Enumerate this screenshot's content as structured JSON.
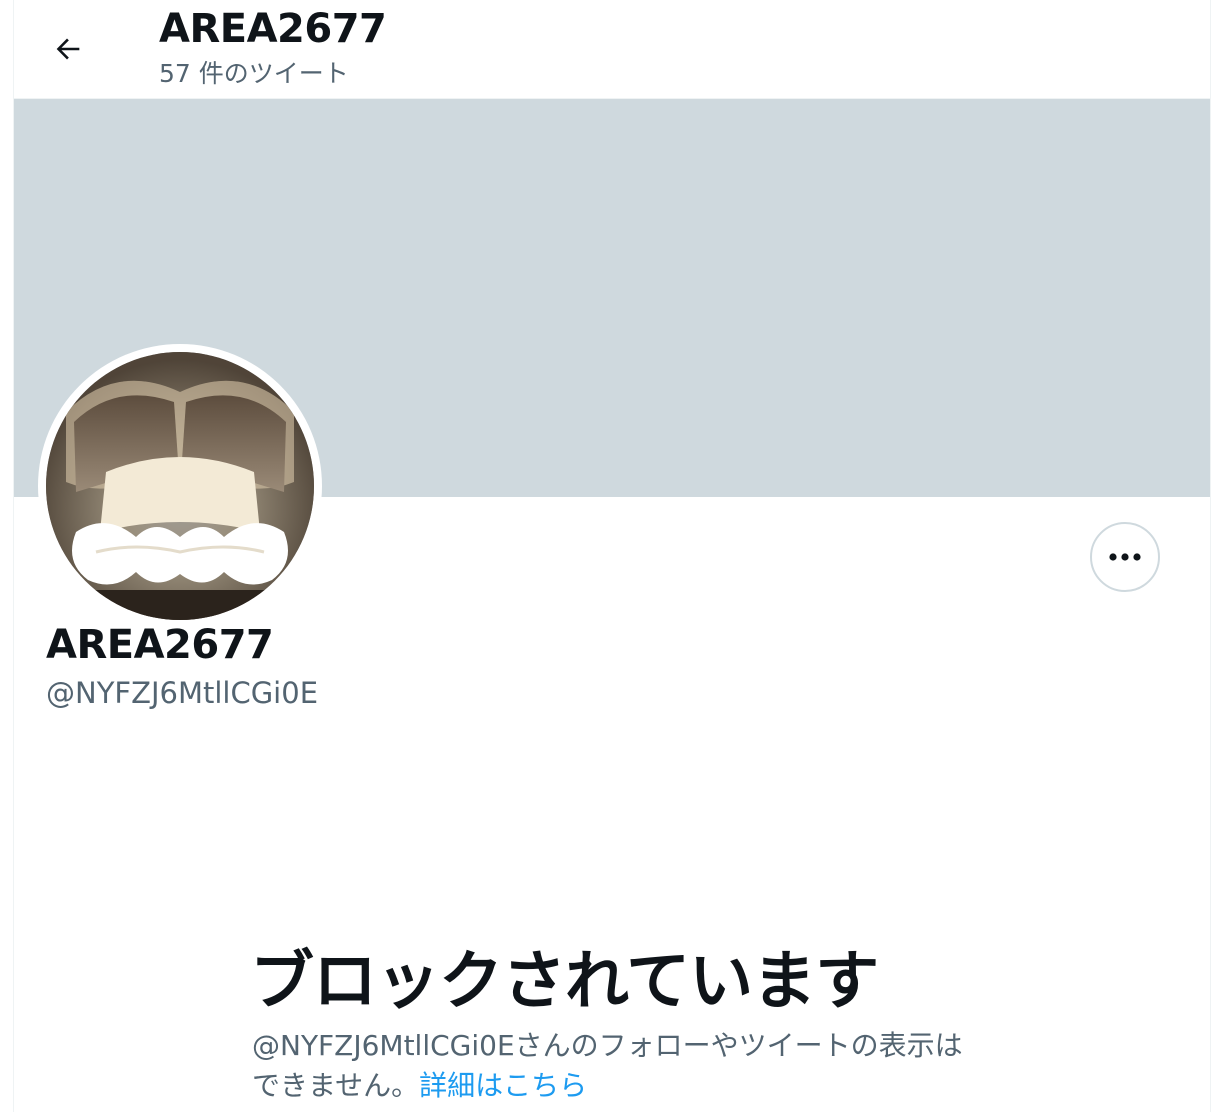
{
  "header": {
    "back_icon": "arrow-left-icon",
    "title": "AREA2677",
    "tweet_count": "57 件のツイート"
  },
  "banner": {
    "color": "#cfd9de"
  },
  "profile": {
    "avatar": "lamp-photo-avatar",
    "more_icon": "more-horizontal-icon",
    "name": "AREA2677",
    "handle": "@NYFZJ6MtllCGi0E"
  },
  "blocked": {
    "title": "ブロックされています",
    "message": "@NYFZJ6MtllCGi0Eさんのフォローやツイートの表示はできません。",
    "link_text": "詳細はこちら",
    "link_color": "#1d9bf0"
  }
}
